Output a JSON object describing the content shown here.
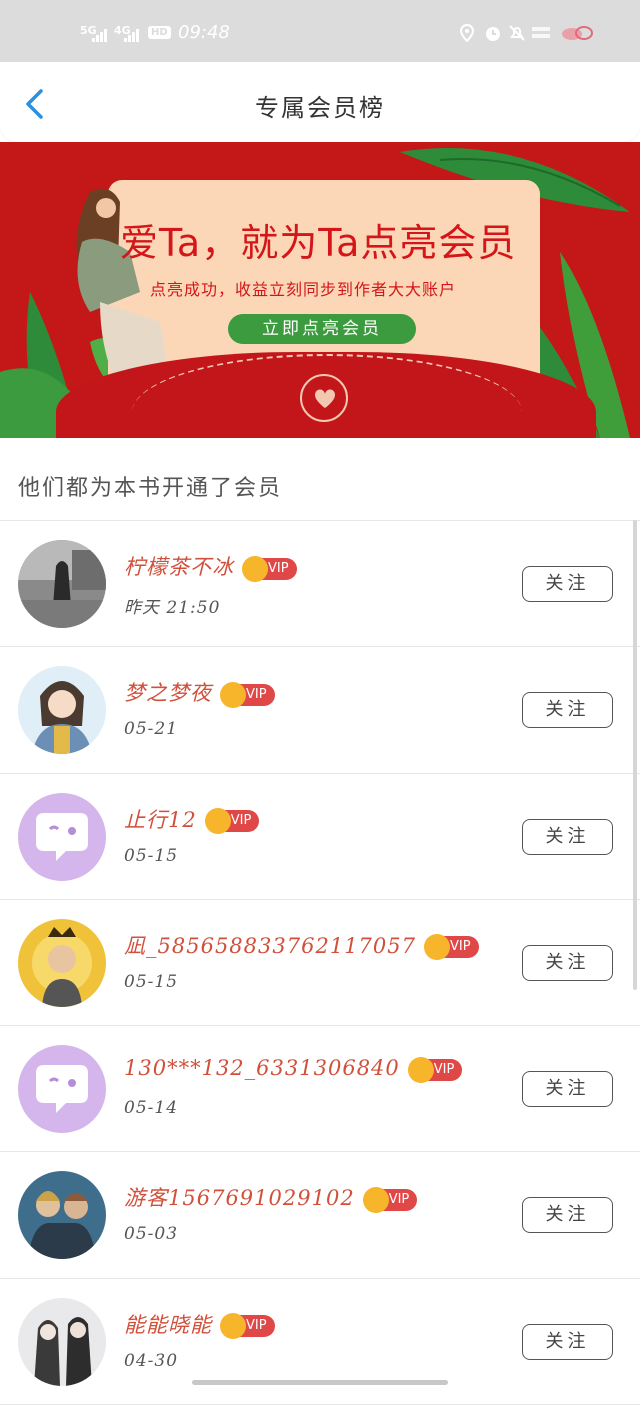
{
  "status_bar": {
    "signal_1": "5G",
    "signal_2": "4G",
    "hd_badge": "HD",
    "time": "09:48",
    "icons": [
      "location-icon",
      "alarm-icon",
      "mute-icon",
      "network-speed-icon",
      "battery-icon"
    ]
  },
  "header": {
    "title": "专属会员榜",
    "back_icon": "chevron-left-icon"
  },
  "banner": {
    "headline": "爱Ta，就为Ta点亮会员",
    "subline": "点亮成功，收益立刻同步到作者大大账户",
    "button_label": "立即点亮会员"
  },
  "section": {
    "title": "他们都为本书开通了会员"
  },
  "members": [
    {
      "name": "柠檬茶不冰",
      "date": "昨天 21:50",
      "vip": "VIP",
      "follow": "关注",
      "avatar": "photo"
    },
    {
      "name": "梦之梦夜",
      "date": "05-21",
      "vip": "VIP",
      "follow": "关注",
      "avatar": "cartoon"
    },
    {
      "name": "止行12",
      "date": "05-15",
      "vip": "VIP",
      "follow": "关注",
      "avatar": "default"
    },
    {
      "name": "凪_5856588337621​17057",
      "date": "05-15",
      "vip": "VIP",
      "follow": "关注",
      "avatar": "photo-yellow"
    },
    {
      "name": "130***132_6331306840",
      "date": "05-14",
      "vip": "VIP",
      "follow": "关注",
      "avatar": "default"
    },
    {
      "name": "游客1567691029102",
      "date": "05-03",
      "vip": "VIP",
      "follow": "关注",
      "avatar": "photo-blue"
    },
    {
      "name": "能能晓能",
      "date": "04-30",
      "vip": "VIP",
      "follow": "关注",
      "avatar": "photo-gray"
    }
  ],
  "colors": {
    "name_red": "#d0503b",
    "vip_red": "#e04848",
    "banner_red": "#c41818",
    "button_green": "#3c9b3e",
    "back_blue": "#2b8fe0"
  }
}
